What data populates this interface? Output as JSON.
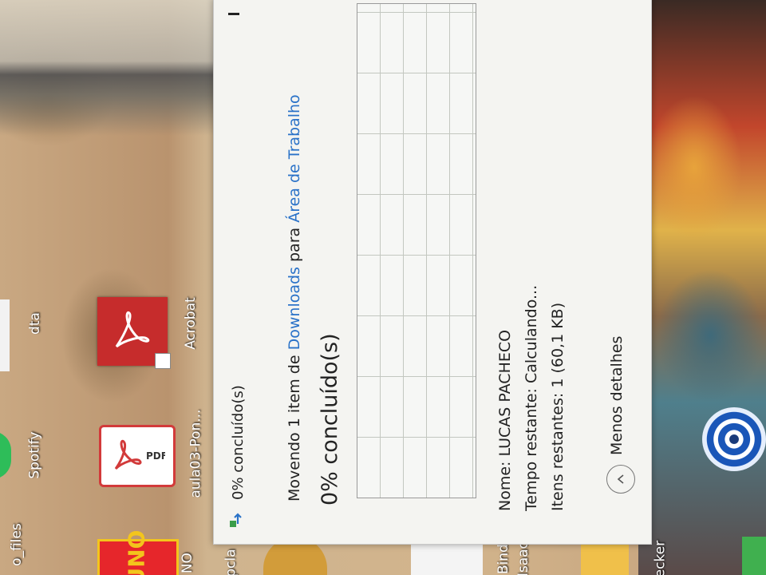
{
  "desktop": {
    "labels": [
      "Spotify",
      "aula03-Pon...",
      "Acrobat",
      "o_files",
      "dta",
      "Bind",
      "Isaac",
      "ecker",
      "NO",
      "pcla"
    ],
    "pdf_badge": "PDF",
    "uno_text": "UNO"
  },
  "dialog": {
    "header_title": "0% concluído(s)",
    "status_prefix": "Movendo 1 item de ",
    "source": "Downloads",
    "status_middle": " para ",
    "destination": "Área de Trabalho",
    "percent_complete": "0% concluído(s)",
    "progress_fraction": 0,
    "info": {
      "name_label": "Nome:",
      "name_value": "LUCAS PACHECO",
      "time_label": "Tempo restante:",
      "time_value": "Calculando...",
      "items_label": "Itens restantes:",
      "items_value": "1 (60,1 KB)"
    },
    "toggle_details": "Menos detalhes"
  },
  "colors": {
    "link": "#2a72c8",
    "dialog_bg": "#f4f4f1"
  },
  "icons": [
    "move-progress-icon",
    "minimize-icon",
    "chevron-up-icon",
    "pdf-icon",
    "acrobat-icon"
  ]
}
